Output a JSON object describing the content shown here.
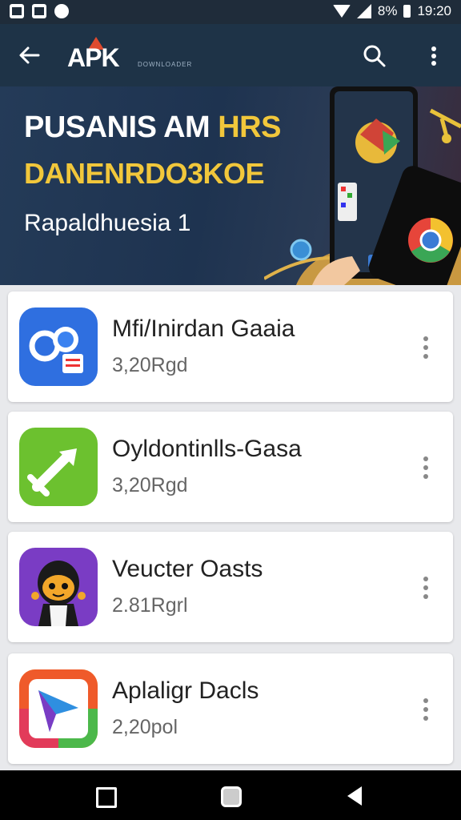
{
  "status_bar": {
    "battery": "8%",
    "time": "19:20"
  },
  "app_bar": {
    "logo_text": "APK",
    "logo_subtext": "DOWNLOADER"
  },
  "banner": {
    "title_line1_part1": "PUSANIS AM",
    "title_line1_part2": "HRS",
    "title_line2": "DANENRDO3KOE",
    "subtitle": "Rapaldhuesia 1"
  },
  "apps": [
    {
      "name": "Mfi/Inirdan Gaaia",
      "meta": "3,20Rgd",
      "icon": "blue-glasses-icon"
    },
    {
      "name": "Oyldontinlls-Gasa",
      "meta": "3,20Rgd",
      "icon": "green-tool-icon"
    },
    {
      "name": "Veucter Oasts",
      "meta": "2.81Rgrl",
      "icon": "ninja-character-icon"
    },
    {
      "name": "Aplaligr Dacls",
      "meta": "2,20pol",
      "icon": "colorful-play-icon"
    }
  ],
  "colors": {
    "app_bar": "#1e3347",
    "status_bar": "#1f2c3a",
    "accent_yellow": "#f1c73b",
    "logo_accent": "#e04a2e"
  }
}
